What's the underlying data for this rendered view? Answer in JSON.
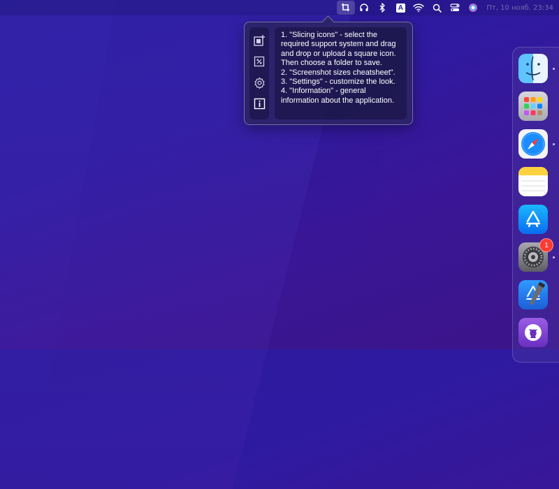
{
  "menubar": {
    "datetime": "Пт, 10 нояб.  23:34",
    "icons": [
      "app-slicer-icon",
      "headphones-icon",
      "bluetooth-icon",
      "input-source-icon",
      "wifi-icon",
      "spotlight-search-icon",
      "control-center-icon",
      "siri-icon"
    ],
    "input_source_letter": "A"
  },
  "popover": {
    "text": "1. \"Slicing icons\" - select the required support system and drag and drop or upload a square icon. Then choose a folder to save.\n2. \"Screenshot sizes cheatsheet\".\n3. \"Settings\" - customize the look.\n4. \"Information\" - general information about the application.",
    "sidebar": [
      "slicing-icons",
      "screenshot-sizes",
      "settings",
      "information"
    ]
  },
  "dock": {
    "apps": [
      "Finder",
      "Launchpad",
      "Safari",
      "Notes",
      "App Store",
      "System Settings",
      "Xcode",
      "GitHub Desktop"
    ],
    "settings_badge": "1"
  }
}
